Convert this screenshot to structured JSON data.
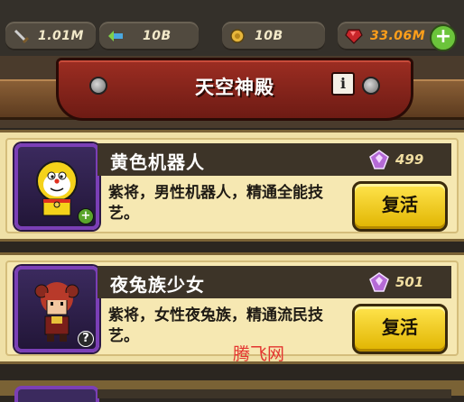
{
  "resources": {
    "attack": {
      "icon": "sword-icon",
      "value": "1.01M"
    },
    "exp": {
      "icon": "exp-icon",
      "value": "10B"
    },
    "gold": {
      "icon": "coin-icon",
      "value": "10B"
    },
    "gems": {
      "icon": "red-gem-icon",
      "value": "33.06M",
      "color": "#ff9f1a"
    }
  },
  "header": {
    "title": "天空神殿",
    "info_label": "i"
  },
  "heroes": [
    {
      "name": "黄色机器人",
      "cost": "499",
      "description": "紫将，男性机器人，精通全能技艺。",
      "button_label": "复活",
      "badge": "+",
      "badge_color": "#5aa52b"
    },
    {
      "name": "夜兔族少女",
      "cost": "501",
      "description": "紫将，女性夜兔族，精通流民技艺。",
      "button_label": "复活",
      "badge": "?",
      "badge_color": "#2a2a2a"
    }
  ],
  "watermark": "腾飞网",
  "colors": {
    "frame_purple": "#7b3fb6",
    "button_yellow": "#f2cc1a",
    "banner_red": "#8e271d"
  }
}
